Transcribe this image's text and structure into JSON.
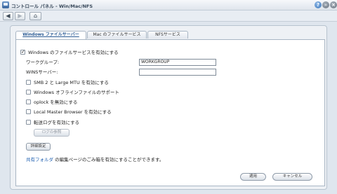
{
  "window": {
    "title": "コントロール パネル - Win/Mac/NFS",
    "help_glyph": "?",
    "min_glyph": "–",
    "close_glyph": "×"
  },
  "nav": {
    "back_glyph": "◀",
    "forward_glyph": "▶",
    "home_glyph": "⌂"
  },
  "tabs": [
    {
      "label": "Windows ファイルサーバー",
      "active": true
    },
    {
      "label": "Mac のファイルサービス",
      "active": false
    },
    {
      "label": "NFSサービス",
      "active": false
    }
  ],
  "windows": {
    "enable_label": "Windows のファイルサービスを有効にする",
    "enable_checked": true,
    "workgroup_label": "ワークグループ:",
    "workgroup_value": "WORKGROUP",
    "wins_label": "WINSサーバー:",
    "wins_value": "",
    "options": [
      {
        "label": "SMB 2 と Large MTU を有効にする",
        "checked": false
      },
      {
        "label": "Windows オフラインファイルのサポート",
        "checked": false
      },
      {
        "label": "oplock を無効にする",
        "checked": false
      },
      {
        "label": "Local Master Browser を有効にする",
        "checked": false
      },
      {
        "label": "転送ログを有効にする",
        "checked": false
      }
    ],
    "log_button": "ログの参照",
    "advanced_button": "詳細設定",
    "note_link": "共有フォルダ",
    "note_text": " の編集ページのごみ箱を有効にすることができます。"
  },
  "footer": {
    "apply_label": "適用",
    "cancel_label": "キャンセル"
  }
}
